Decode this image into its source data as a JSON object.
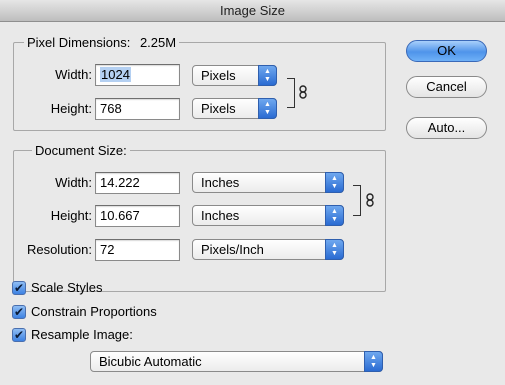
{
  "window": {
    "title": "Image Size"
  },
  "pixel_dimensions": {
    "legend": "Pixel Dimensions:",
    "size": "2.25M",
    "width": {
      "label": "Width:",
      "value": "1024",
      "unit": "Pixels"
    },
    "height": {
      "label": "Height:",
      "value": "768",
      "unit": "Pixels"
    }
  },
  "document_size": {
    "legend": "Document Size:",
    "width": {
      "label": "Width:",
      "value": "14.222",
      "unit": "Inches"
    },
    "height": {
      "label": "Height:",
      "value": "10.667",
      "unit": "Inches"
    },
    "resolution": {
      "label": "Resolution:",
      "value": "72",
      "unit": "Pixels/Inch"
    }
  },
  "buttons": {
    "ok": "OK",
    "cancel": "Cancel",
    "auto": "Auto..."
  },
  "options": {
    "scale_styles": {
      "label": "Scale Styles",
      "checked": true
    },
    "constrain_proportions": {
      "label": "Constrain Proportions",
      "checked": true
    },
    "resample_image": {
      "label": "Resample Image:",
      "checked": true
    }
  },
  "resample_method": "Bicubic Automatic",
  "icons": {
    "check": "✔",
    "link": "chain-link-icon",
    "popup_arrows": "▲▼"
  }
}
